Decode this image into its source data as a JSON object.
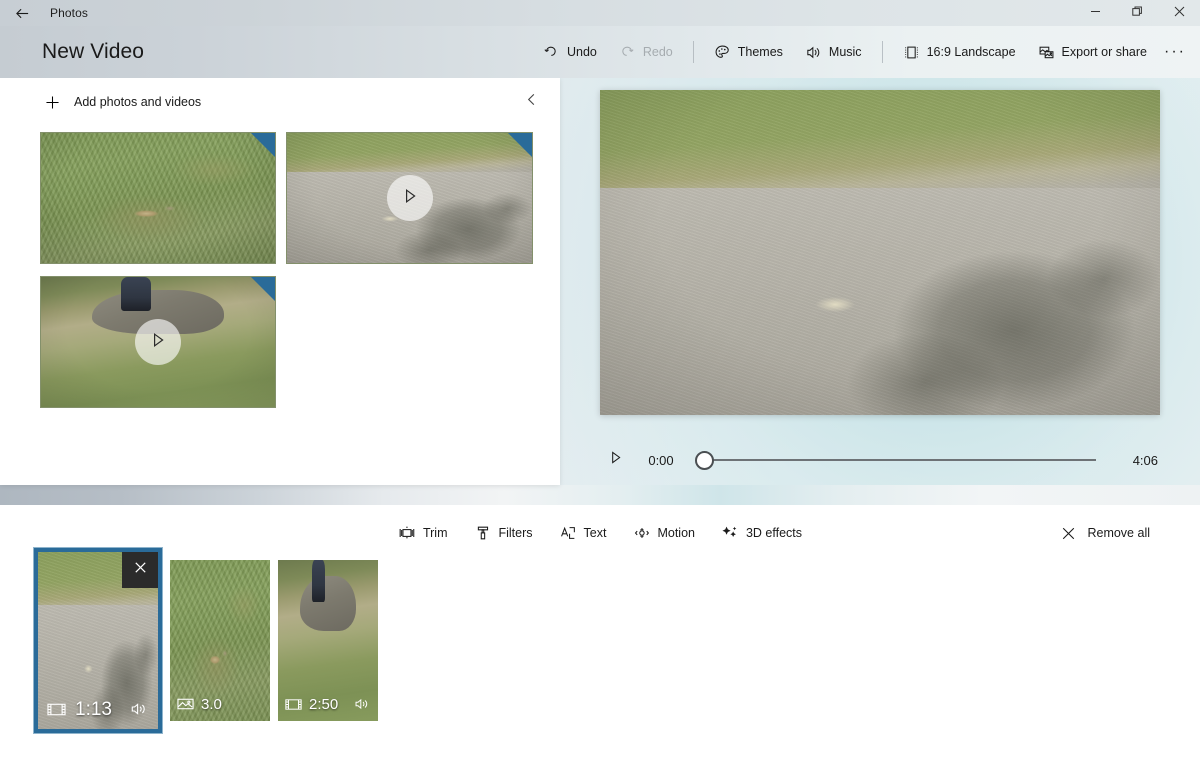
{
  "window": {
    "app_name": "Photos",
    "back_icon": "back-arrow-icon",
    "minimize_label": "–",
    "maximize_label": "❐",
    "close_label": "✕"
  },
  "header": {
    "title": "New Video",
    "toolbar": [
      {
        "id": "undo",
        "label": "Undo",
        "icon": "undo-icon",
        "disabled": false
      },
      {
        "id": "redo",
        "label": "Redo",
        "icon": "redo-icon",
        "disabled": true
      },
      {
        "id": "themes",
        "label": "Themes",
        "icon": "palette-icon",
        "disabled": false
      },
      {
        "id": "music",
        "label": "Music",
        "icon": "speaker-icon",
        "disabled": false
      },
      {
        "id": "aspect",
        "label": "16:9 Landscape",
        "icon": "aspect-ratio-icon",
        "disabled": false
      },
      {
        "id": "export",
        "label": "Export or share",
        "icon": "export-icon",
        "disabled": false
      }
    ],
    "more_label": "···"
  },
  "library": {
    "add_label": "Add photos and videos",
    "add_icon": "plus-icon",
    "collapse_icon": "chevron-left-icon",
    "tiles": [
      {
        "id": "tile-1",
        "scene": "grass",
        "kind": "photo",
        "selected_corner": true,
        "play": false
      },
      {
        "id": "tile-2",
        "scene": "walk",
        "kind": "video",
        "selected_corner": true,
        "play": true
      },
      {
        "id": "tile-3",
        "scene": "rock",
        "kind": "video",
        "selected_corner": true,
        "play": true
      }
    ]
  },
  "preview": {
    "scene": "walk",
    "play_icon": "play-icon",
    "current_time": "0:00",
    "total_time": "4:06",
    "progress_percent": 2
  },
  "edit_toolbar": {
    "tools": [
      {
        "id": "trim",
        "label": "Trim",
        "icon": "trim-icon"
      },
      {
        "id": "filters",
        "label": "Filters",
        "icon": "filter-icon"
      },
      {
        "id": "text",
        "label": "Text",
        "icon": "text-icon"
      },
      {
        "id": "motion",
        "label": "Motion",
        "icon": "motion-icon"
      },
      {
        "id": "effects3d",
        "label": "3D effects",
        "icon": "sparkle-icon"
      }
    ],
    "remove_all_label": "Remove all",
    "remove_all_icon": "close-x-icon"
  },
  "storyboard": {
    "clips": [
      {
        "id": "clip-1",
        "scene": "walk",
        "duration": "1:13",
        "type_icon": "film-icon",
        "has_audio": true,
        "selected": true,
        "close_icon": "close-x-icon"
      },
      {
        "id": "clip-2",
        "scene": "grass",
        "duration": "3.0",
        "type_icon": "photo-icon",
        "has_audio": false,
        "selected": false,
        "close_icon": ""
      },
      {
        "id": "clip-3",
        "scene": "rock",
        "duration": "2:50",
        "type_icon": "film-icon",
        "has_audio": true,
        "selected": false,
        "close_icon": ""
      }
    ]
  },
  "colors": {
    "accent": "#2a6b99",
    "panel_bg": "#ffffff",
    "text": "#1a1a1a",
    "disabled_text": "#a6acb0"
  }
}
